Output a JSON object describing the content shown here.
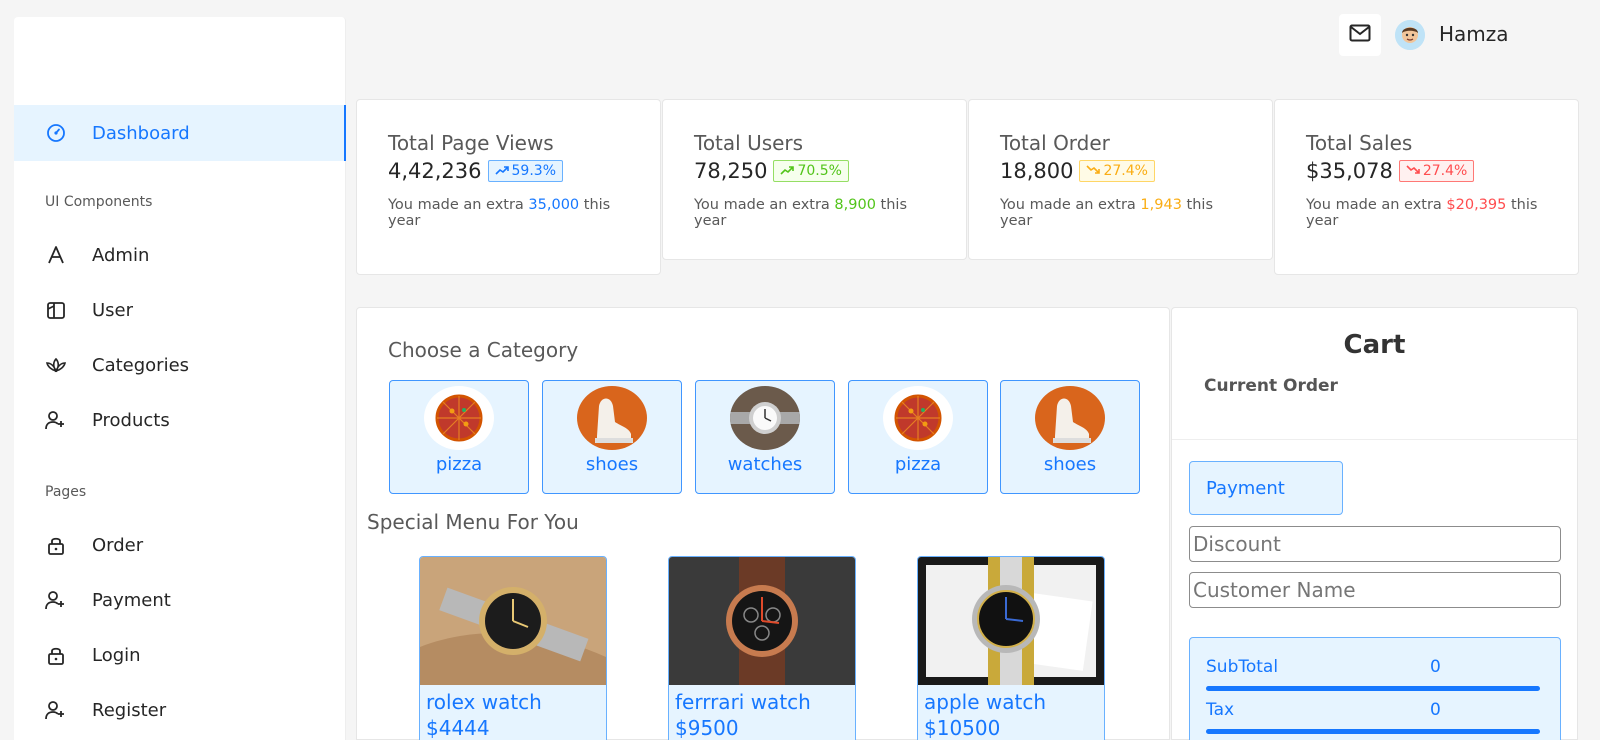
{
  "sidebar": {
    "items": [
      {
        "label": "Dashboard",
        "icon": "dashboard-icon"
      },
      {
        "label": "Admin",
        "icon": "font-icon"
      },
      {
        "label": "User",
        "icon": "layout-icon"
      },
      {
        "label": "Categories",
        "icon": "lotus-icon"
      },
      {
        "label": "Products",
        "icon": "user-add-icon"
      },
      {
        "label": "Order",
        "icon": "lock-icon"
      },
      {
        "label": "Payment",
        "icon": "user-add-icon"
      },
      {
        "label": "Login",
        "icon": "lock-icon"
      },
      {
        "label": "Register",
        "icon": "user-add-icon"
      }
    ],
    "groups": {
      "ui_components": "UI Components",
      "pages": "Pages"
    }
  },
  "header": {
    "user_name": "Hamza",
    "mail_icon": "mail-icon"
  },
  "stats": [
    {
      "title": "Total Page Views",
      "value": "4,42,236",
      "badge": "59.3%",
      "trend": "up",
      "foot_pre": "You made an extra ",
      "foot_hl": "35,000",
      "foot_post": " this year",
      "color": "#1677ff"
    },
    {
      "title": "Total Users",
      "value": "78,250",
      "badge": "70.5%",
      "trend": "up",
      "foot_pre": "You made an extra ",
      "foot_hl": "8,900",
      "foot_post": " this year",
      "color": "#52c41a"
    },
    {
      "title": "Total Order",
      "value": "18,800",
      "badge": "27.4%",
      "trend": "down",
      "foot_pre": "You made an extra ",
      "foot_hl": "1,943",
      "foot_post": " this year",
      "color": "#faad14"
    },
    {
      "title": "Total Sales",
      "value": "$35,078",
      "badge": "27.4%",
      "trend": "down",
      "foot_pre": "You made an extra ",
      "foot_hl": "$20,395",
      "foot_post": " this year",
      "color": "#ff4d4f"
    }
  ],
  "categories": {
    "title": "Choose a Category",
    "items": [
      "pizza",
      "shoes",
      "watches",
      "pizza",
      "shoes"
    ]
  },
  "menu": {
    "title": "Special Menu For You",
    "products": [
      {
        "name": "rolex watch",
        "price": "$4444"
      },
      {
        "name": "ferrrari watch",
        "price": "$9500"
      },
      {
        "name": "apple watch",
        "price": "$10500"
      }
    ]
  },
  "cart": {
    "title": "Cart",
    "subtitle": "Current Order",
    "payment_label": "Payment",
    "discount_placeholder": "Discount",
    "customer_placeholder": "Customer Name",
    "subtotal_label": "SubTotal",
    "subtotal_value": "0",
    "tax_label": "Tax",
    "tax_value": "0"
  }
}
